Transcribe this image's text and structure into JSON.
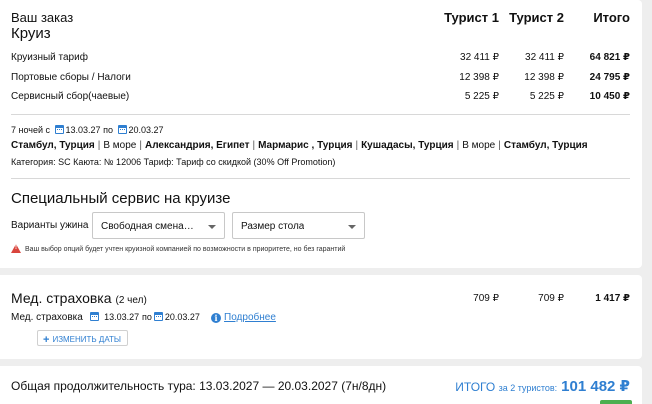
{
  "order": {
    "your_order": "Ваш заказ",
    "cruise": "Круиз",
    "columns": [
      "Турист 1",
      "Турист 2",
      "Итого"
    ],
    "rows": [
      {
        "label": "Круизный тариф",
        "t1": "32 411 ₽",
        "t2": "32 411 ₽",
        "total": "64 821 ₽"
      },
      {
        "label": "Портовые сборы / Налоги",
        "t1": "12 398 ₽",
        "t2": "12 398 ₽",
        "total": "24 795 ₽"
      },
      {
        "label": "Сервисный сбор(чаевые)",
        "t1": "5 225 ₽",
        "t2": "5 225 ₽",
        "total": "10 450 ₽"
      }
    ],
    "nights_prefix": "7 ночей с",
    "date_from": "13.03.27",
    "date_by": "по",
    "date_to": "20.03.27",
    "route": [
      {
        "text": "Стамбул, Турция",
        "bold": true
      },
      {
        "text": "В море",
        "bold": false
      },
      {
        "text": "Александрия, Египет",
        "bold": true
      },
      {
        "text": "Мармарис , Турция",
        "bold": true
      },
      {
        "text": "Кушадасы, Турция",
        "bold": true
      },
      {
        "text": "В море",
        "bold": false
      },
      {
        "text": "Стамбул, Турция",
        "bold": true
      }
    ],
    "cabin_line": "Категория: SC  Каюта: № 12006  Тариф: Тариф со скидкой (30% Off Promotion)"
  },
  "special": {
    "title": "Специальный сервис на круизе",
    "dinner_label": "Варианты ужина",
    "dinner_value": "Свободная смена питания",
    "table_value": "Размер стола",
    "warning": "Ваш выбор опций будет учтен круизной компанией по возможности в приоритете, но без гарантий"
  },
  "insurance": {
    "title": "Мед. страховка",
    "people": "(2 чел)",
    "t1": "709 ₽",
    "t2": "709 ₽",
    "total": "1 417 ₽",
    "sub_label": "Мед. страховка",
    "date_from": "13.03.27",
    "date_by": "по",
    "date_to": "20.03.27",
    "more_link": "Подробнее",
    "change_dates": "ИЗМЕНИТЬ ДАТЫ"
  },
  "footer": {
    "duration": "Общая продолжительность тура: 13.03.2027 — 20.03.2027 (7н/8дн)",
    "total_label": "ИТОГО",
    "total_for": "за 2 туристов:",
    "total_value": "101 482 ₽"
  },
  "colors": {
    "accent": "#2f7fd1",
    "warning": "#d9453d",
    "green": "#4caf50"
  }
}
